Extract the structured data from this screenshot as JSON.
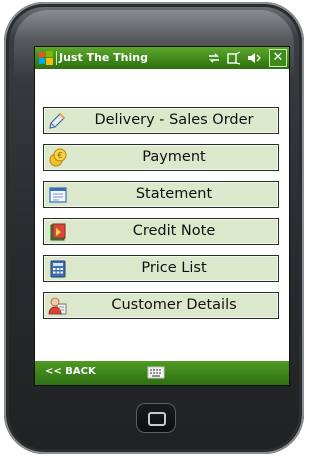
{
  "device": {
    "accent": "#4c9a22"
  },
  "statusbar": {
    "title": "Just The Thing",
    "icons": [
      "windows-flag-icon",
      "connectivity-icon",
      "signal-icon",
      "volume-icon"
    ],
    "close_label": "✕"
  },
  "menu": {
    "items": [
      {
        "label": "Delivery - Sales Order",
        "icon": "delivery-pencil-icon"
      },
      {
        "label": "Payment",
        "icon": "payment-coins-icon"
      },
      {
        "label": "Statement",
        "icon": "statement-document-icon"
      },
      {
        "label": "Credit Note",
        "icon": "credit-note-book-icon"
      },
      {
        "label": "Price List",
        "icon": "price-list-calculator-icon"
      },
      {
        "label": "Customer Details",
        "icon": "customer-contact-icon"
      }
    ]
  },
  "softbar": {
    "back_label": "<< BACK",
    "keyboard_icon": "keyboard-icon"
  }
}
